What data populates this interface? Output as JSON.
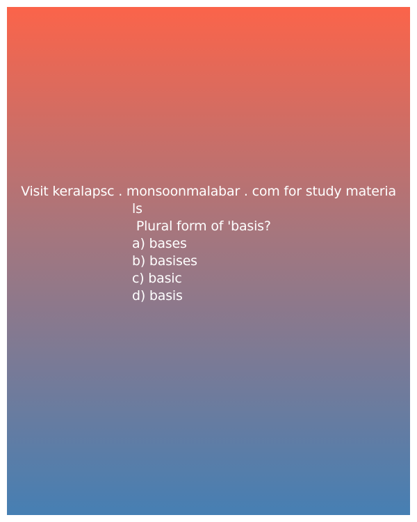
{
  "card": {
    "visit_line_1": "Visit keralapsc . monsoonmalabar . com for study materia",
    "visit_line_2": "ls",
    "question": " Plural form of 'basis?",
    "options": [
      "a) bases",
      "b) basises",
      "c) basic",
      "d) basis"
    ],
    "colors": {
      "gradient_top": "#fb644a",
      "gradient_bottom": "#467fb3",
      "text": "#ffffff"
    }
  }
}
